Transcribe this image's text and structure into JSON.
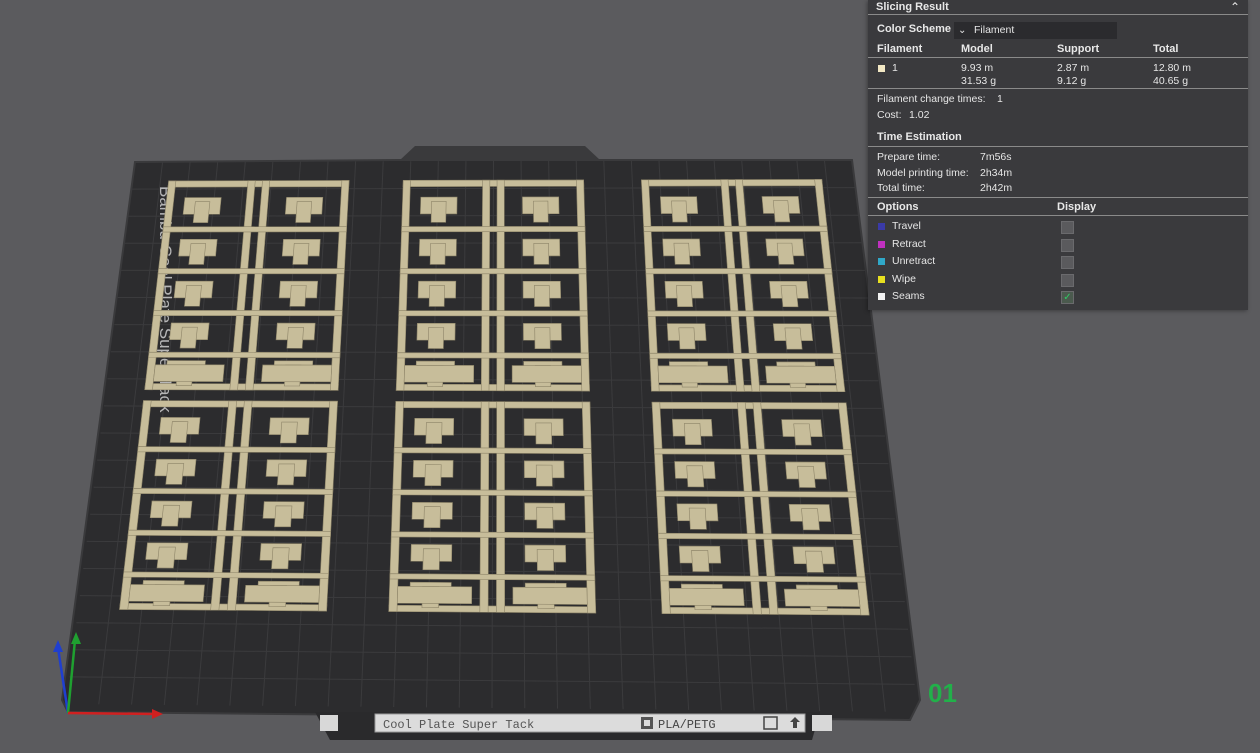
{
  "panel": {
    "title": "Slicing Result",
    "color_scheme_label": "Color Scheme",
    "color_scheme_value": "Filament",
    "columns": {
      "filament": "Filament",
      "model": "Model",
      "support": "Support",
      "total": "Total"
    },
    "filament_row": {
      "id": "1",
      "color": "#f2e8c4",
      "model_length": "9.93 m",
      "model_weight": "31.53 g",
      "support_length": "2.87 m",
      "support_weight": "9.12 g",
      "total_length": "12.80 m",
      "total_weight": "40.65 g"
    },
    "filament_change_label": "Filament change times:",
    "filament_change_value": "1",
    "cost_label": "Cost:",
    "cost_value": "1.02",
    "time_title": "Time Estimation",
    "prepare_label": "Prepare time:",
    "prepare_value": "7m56s",
    "model_time_label": "Model printing time:",
    "model_time_value": "2h34m",
    "total_time_label": "Total time:",
    "total_time_value": "2h42m",
    "options_label": "Options",
    "display_label": "Display",
    "options": [
      {
        "name": "Travel",
        "color": "#3a3aa8",
        "checked": false
      },
      {
        "name": "Retract",
        "color": "#c030c0",
        "checked": false
      },
      {
        "name": "Unretract",
        "color": "#30a8c8",
        "checked": false
      },
      {
        "name": "Wipe",
        "color": "#e8e020",
        "checked": false
      },
      {
        "name": "Seams",
        "color": "#f2f2f2",
        "checked": true
      }
    ]
  },
  "plate": {
    "label": "Cool Plate Super Tack",
    "filament_type": "PLA/PETG",
    "plate_number": "01",
    "side_text": "Bambu Cool Plate Super Tack",
    "plate_color": "#2c2c2e",
    "model_color": "#c7bd9a",
    "accent_green": "#22b04a"
  }
}
